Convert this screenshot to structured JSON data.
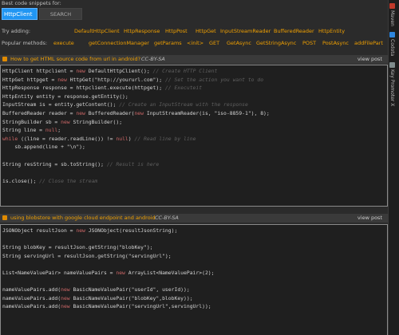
{
  "header": {
    "title": "Best code snippets for:"
  },
  "search": {
    "value": "HttpClient",
    "button_label": "SEARCH"
  },
  "try_adding": {
    "label": "Try adding:",
    "items": [
      "DefaultHttpClient",
      "HttpResponse",
      "HttpPost",
      "HttpGet",
      "InputStreamReader",
      "BufferedReader",
      "HttpEntity"
    ]
  },
  "popular_methods": {
    "label": "Popular methods:",
    "items": [
      "execute",
      "getConnectionManager",
      "getParams",
      "<init>",
      "GET",
      "GetAsync",
      "GetStringAsync",
      "POST",
      "PostAsync",
      "addFilePart"
    ]
  },
  "posts": [
    {
      "title": "How to get HTML source code from url in android?",
      "license": "CC-BY-SA",
      "view_label": "view post",
      "code": [
        [
          [
            "t",
            "HttpClient httpclient = "
          ],
          [
            "k",
            "new"
          ],
          [
            "t",
            " DefaultHttpClient(); "
          ],
          [
            "c",
            "// Create HTTP Client"
          ]
        ],
        [
          [
            "t",
            "HttpGet httpget = "
          ],
          [
            "k",
            "new"
          ],
          [
            "t",
            " HttpGet(\"http://yoururl.com\"); "
          ],
          [
            "c",
            "// Set the action you want to do"
          ]
        ],
        [
          [
            "t",
            "HttpResponse response = httpclient.execute(httpget); "
          ],
          [
            "c",
            "// Executeit"
          ]
        ],
        [
          [
            "t",
            "HttpEntity entity = response.getEntity();"
          ]
        ],
        [
          [
            "t",
            "InputStream is = entity.getContent(); "
          ],
          [
            "c",
            "// Create an InputStream with the response"
          ]
        ],
        [
          [
            "t",
            "BufferedReader reader = "
          ],
          [
            "k",
            "new"
          ],
          [
            "t",
            " BufferedReader("
          ],
          [
            "k",
            "new"
          ],
          [
            "t",
            " InputStreamReader(is, \"iso-8859-1\"), 8);"
          ]
        ],
        [
          [
            "t",
            "StringBuilder sb = "
          ],
          [
            "k",
            "new"
          ],
          [
            "t",
            " StringBuilder();"
          ]
        ],
        [
          [
            "t",
            "String line = "
          ],
          [
            "k",
            "null"
          ],
          [
            "t",
            ";"
          ]
        ],
        [
          [
            "k",
            "while"
          ],
          [
            "t",
            " ((line = reader.readLine()) != "
          ],
          [
            "k",
            "null"
          ],
          [
            "t",
            ") "
          ],
          [
            "c",
            "// Read line by line"
          ]
        ],
        [
          [
            "t",
            "    sb.append(line + \"\\n\");"
          ]
        ],
        [
          [
            "t",
            ""
          ]
        ],
        [
          [
            "t",
            "String resString = sb.toString(); "
          ],
          [
            "c",
            "// Result is here"
          ]
        ],
        [
          [
            "t",
            ""
          ]
        ],
        [
          [
            "t",
            "is.close(); "
          ],
          [
            "c",
            "// Close the stream"
          ]
        ]
      ]
    },
    {
      "title": "using blobstore with google cloud endpoint and android",
      "license": "CC-BY-SA",
      "view_label": "view post",
      "code": [
        [
          [
            "t",
            "JSONObject resultJson = "
          ],
          [
            "k",
            "new"
          ],
          [
            "t",
            " JSONObject(resultJsonString);"
          ]
        ],
        [
          [
            "t",
            ""
          ]
        ],
        [
          [
            "t",
            "String blobKey = resultJson.getString(\"blobKey\");"
          ]
        ],
        [
          [
            "t",
            "String servingUrl = resultJson.getString(\"servingUrl\");"
          ]
        ],
        [
          [
            "t",
            ""
          ]
        ],
        [
          [
            "t",
            "List<NameValuePair> nameValuePairs = "
          ],
          [
            "k",
            "new"
          ],
          [
            "t",
            " ArrayList<NameValuePair>(2);"
          ]
        ],
        [
          [
            "t",
            ""
          ]
        ],
        [
          [
            "t",
            "nameValuePairs.add("
          ],
          [
            "k",
            "new"
          ],
          [
            "t",
            " BasicNameValuePair(\"userId\", userId));"
          ]
        ],
        [
          [
            "t",
            "nameValuePairs.add("
          ],
          [
            "k",
            "new"
          ],
          [
            "t",
            " BasicNameValuePair(\"blobKey\",blobKey));"
          ]
        ],
        [
          [
            "t",
            "nameValuePairs.add("
          ],
          [
            "k",
            "new"
          ],
          [
            "t",
            " BasicNameValuePair(\"servingUrl\",servingUrl));"
          ]
        ]
      ]
    }
  ],
  "sidebar": {
    "tabs": [
      {
        "label": "Maven",
        "icon": "maven-icon",
        "color": "#c0392b"
      },
      {
        "label": "Codota",
        "icon": "codota-icon",
        "color": "#2e86de"
      },
      {
        "label": "Key Promoter X",
        "icon": "key-promoter-icon",
        "color": "#7f8c8d"
      }
    ]
  },
  "colors": {
    "accent": "#f0a000",
    "search_bg": "#2196f3",
    "background": "#2b2b2b"
  }
}
